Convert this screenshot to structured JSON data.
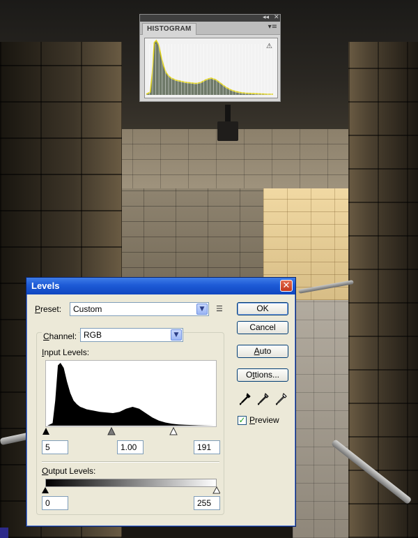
{
  "histogram_panel": {
    "tab_label": "HISTOGRAM",
    "collapse_glyph": "◂◂",
    "close_glyph": "✕",
    "menu_glyph": "▾≡",
    "warning_glyph": "⚠"
  },
  "levels": {
    "title": "Levels",
    "close_glyph": "✕",
    "preset_label": "Preset:",
    "preset_value": "Custom",
    "channel_label": "Channel:",
    "channel_value": "RGB",
    "input_levels_label": "Input Levels:",
    "output_levels_label": "Output Levels:",
    "input_black": "5",
    "input_gamma": "1.00",
    "input_white": "191",
    "output_black": "0",
    "output_white": "255",
    "ok_label": "OK",
    "cancel_label": "Cancel",
    "auto_label": "Auto",
    "options_label": "Options...",
    "preview_label": "Preview",
    "preview_checked": true
  },
  "colors": {
    "title_bar": "#1d5ad6",
    "dialog_bg": "#ece9d8",
    "panel_bg": "#d6d6d6"
  },
  "chart_data": [
    {
      "type": "area",
      "name": "levels_input_histogram",
      "x": [
        0,
        8,
        12,
        16,
        20,
        25,
        30,
        35,
        40,
        45,
        50,
        55,
        60,
        70,
        80,
        90,
        100,
        110,
        120,
        130,
        140,
        150,
        160,
        170,
        180,
        190,
        200,
        210,
        220,
        230,
        240,
        255
      ],
      "values": [
        0,
        4,
        40,
        96,
        100,
        92,
        70,
        52,
        40,
        34,
        30,
        28,
        26,
        24,
        22,
        21,
        20,
        22,
        27,
        30,
        27,
        20,
        13,
        8,
        5,
        3,
        2,
        1.5,
        1,
        0.6,
        0.3,
        0
      ],
      "xlim": [
        0,
        255
      ],
      "ylim": [
        0,
        100
      ]
    },
    {
      "type": "area",
      "name": "histogram_panel",
      "x": [
        0,
        8,
        12,
        16,
        20,
        25,
        30,
        35,
        40,
        45,
        50,
        55,
        60,
        70,
        80,
        90,
        100,
        110,
        120,
        130,
        140,
        150,
        160,
        170,
        180,
        190,
        200,
        210,
        220,
        230,
        240,
        255
      ],
      "values": [
        0,
        4,
        40,
        96,
        100,
        92,
        70,
        52,
        40,
        34,
        30,
        28,
        26,
        24,
        22,
        21,
        20,
        22,
        27,
        30,
        27,
        20,
        13,
        8,
        5,
        3,
        2,
        1.5,
        1,
        0.6,
        0.3,
        0
      ],
      "xlim": [
        0,
        255
      ],
      "ylim": [
        0,
        100
      ]
    }
  ]
}
